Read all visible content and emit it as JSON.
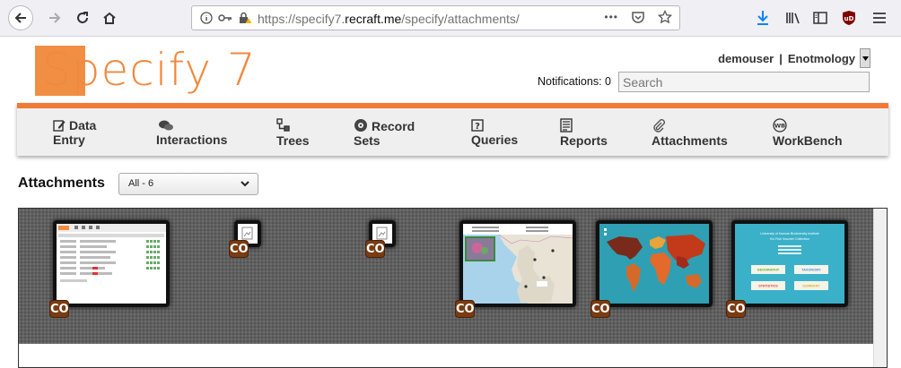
{
  "browser": {
    "url_prefix": "https://specify7.",
    "url_domain": "recraft.me",
    "url_path": "/specify/attachments/",
    "url_more": "•••",
    "icons": [
      "back-icon",
      "forward-icon",
      "reload-icon",
      "home-icon",
      "info-icon",
      "key-icon",
      "lock-warning-icon",
      "pocket-icon",
      "star-icon",
      "download-icon",
      "library-icon",
      "sidebar-icon",
      "ublock-icon",
      "menu-icon"
    ],
    "ublock_label": "uD"
  },
  "header": {
    "logo_text": "Specify 7",
    "user": "demouser",
    "separator": "|",
    "collection": "Enotmology",
    "notifications_label": "Notifications: 0",
    "search_placeholder": "Search"
  },
  "nav": {
    "items": [
      {
        "line1": "Data",
        "line2": "Entry",
        "icon": "data-entry-icon"
      },
      {
        "line1": "",
        "line2": "Interactions",
        "icon": "interactions-icon"
      },
      {
        "line1": "",
        "line2": "Trees",
        "icon": "trees-icon"
      },
      {
        "line1": "Record",
        "line2": "Sets",
        "icon": "record-sets-icon"
      },
      {
        "line1": "",
        "line2": "Queries",
        "icon": "queries-icon"
      },
      {
        "line1": "",
        "line2": "Reports",
        "icon": "reports-icon"
      },
      {
        "line1": "",
        "line2": "Attachments",
        "icon": "attachments-icon"
      },
      {
        "line1": "",
        "line2": "WorkBench",
        "icon": "workbench-icon"
      }
    ],
    "accent_color": "#f07a36"
  },
  "attachments": {
    "title": "Attachments",
    "filter_value": "All - 6",
    "badge_label": "CO",
    "thumbnails": [
      {
        "kind": "screenshot-of-table"
      },
      {
        "kind": "placeholder-icon"
      },
      {
        "kind": "placeholder-icon"
      },
      {
        "kind": "map-michigan"
      },
      {
        "kind": "world-map"
      },
      {
        "kind": "title-slide"
      }
    ],
    "slide": {
      "line1": "University of Kansas Biodiversity Institute",
      "line2": "KU Fish Voucher Collection",
      "buttons": [
        "GEOGRAPHY",
        "TAXONOMY",
        "STATISTICS",
        "SUMMARY"
      ]
    }
  }
}
